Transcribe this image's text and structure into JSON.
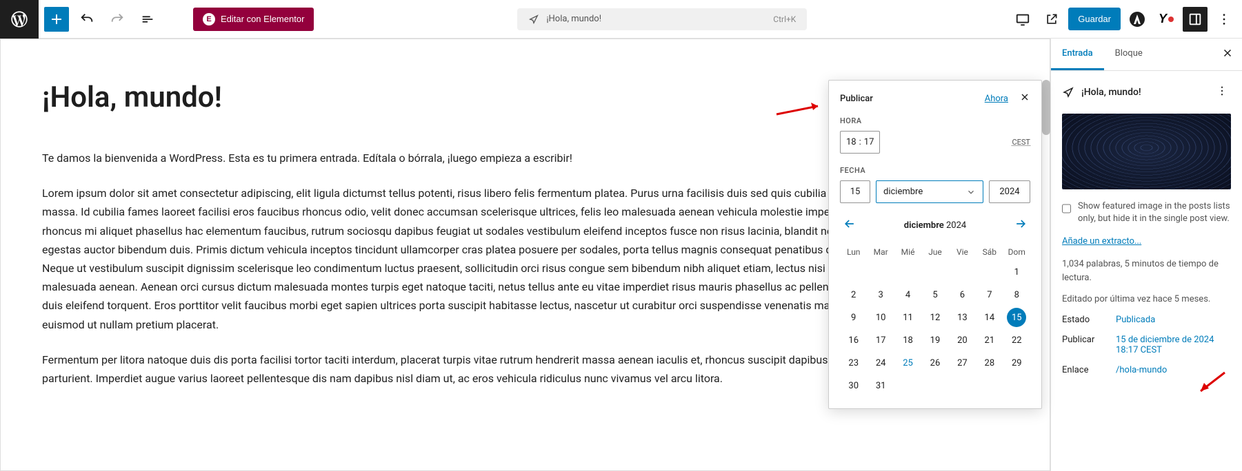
{
  "topbar": {
    "elementor_label": "Editar con Elementor",
    "search_title": "¡Hola, mundo!",
    "shortcut": "Ctrl+K",
    "save_label": "Guardar"
  },
  "post": {
    "title": "¡Hola, mundo!",
    "p1": "Te damos la bienvenida a WordPress. Esta es tu primera entrada. Edítala o bórrala, ¡luego empieza a escribir!",
    "p2": "Lorem ipsum dolor sit amet consectetur adipiscing, elit ligula dictumst tellus potenti, risus libero felis fermentum platea. Purus urna facilisis duis sed quis cubilia libero, eget integer curabitur arcu massa. Id cubilia fames laoreet facilisi eros faucibus rhoncus odio, velit donec accumsan scelerisque ultrices, felis leo malesuada aenean vehicula molestie imperdiet aptent leo. Ut morbi mauris rhoncus mi aliquet phasellus hac elementum faucibus, rutrum sociosqu dapibus feugiat ut sodales vestibulum eleifend inceptos fusce non risus lacinia, blandit neque dignissim lectus dapibus egestas auctor bibendum duis. Primis dictum vehicula inceptos tincidunt ullamcorper cras platea posuere per sodales, porta tellus magnis consequat penatibus duis tempus porttitor maecenas. Neque ut vestibulum suscipit dignissim scelerisque leo condimentum luctus praesent, sollicitudin orci risus congue sem bibendum nibh aliquet etiam, lectus nisi habitasse dapibus sodales mollis id malesuada aenean. Aenean orci cursus dictum malesuada montes turpis eget natoque taciti, netus tellus ante eu vitae imperdiet risus mauris phasellus ac pellentesque placerat fusce elementum duis eleifend torquent. Eros porttitor velit faucibus morbi eget sapien ultrices porta suscipit habitasse lectus, nascetur ut curabitur orci suspendisse venenatis malesuada sem praesent vivamus euismod ut nullam pretium placerat.",
    "p3": "Fermentum per litora natoque duis dis porta facilisi tortor taciti interdum, placerat turpis vitae rutrum hendrerit massa aenean iaculis et, rhoncus suscipit dapibus eget laoreet arcu at habitasse parturient. Imperdiet augue varius laoreet pellentesque dis nam dapibus nisl diam ut, ac eros vehicula ridiculus nunc vivamus vel arcu litora."
  },
  "popover": {
    "title": "Publicar",
    "now": "Ahora",
    "hora_label": "HORA",
    "hour": "18",
    "minute": "17",
    "tz": "CEST",
    "fecha_label": "FECHA",
    "day": "15",
    "month": "diciembre",
    "year": "2024",
    "cal_month": "diciembre",
    "cal_year": "2024",
    "weekdays": [
      "Lun",
      "Mar",
      "Mié",
      "Jue",
      "Vie",
      "Sáb",
      "Dom"
    ],
    "selected_day": 15,
    "today_day": 25
  },
  "sidebar": {
    "tab_entrada": "Entrada",
    "tab_bloque": "Bloque",
    "doc_title": "¡Hola, mundo!",
    "featured_check": "Show featured image in the posts lists only, but hide it in the single post view.",
    "excerpt_link": "Añade un extracto...",
    "wordcount": "1,034 palabras, 5 minutos de tiempo de lectura.",
    "last_edit": "Editado por última vez hace 5 meses.",
    "estado_label": "Estado",
    "estado_value": "Publicada",
    "publicar_label": "Publicar",
    "publicar_value": "15 de diciembre de 2024 18:17 CEST",
    "enlace_label": "Enlace",
    "enlace_value": "/hola-mundo"
  }
}
